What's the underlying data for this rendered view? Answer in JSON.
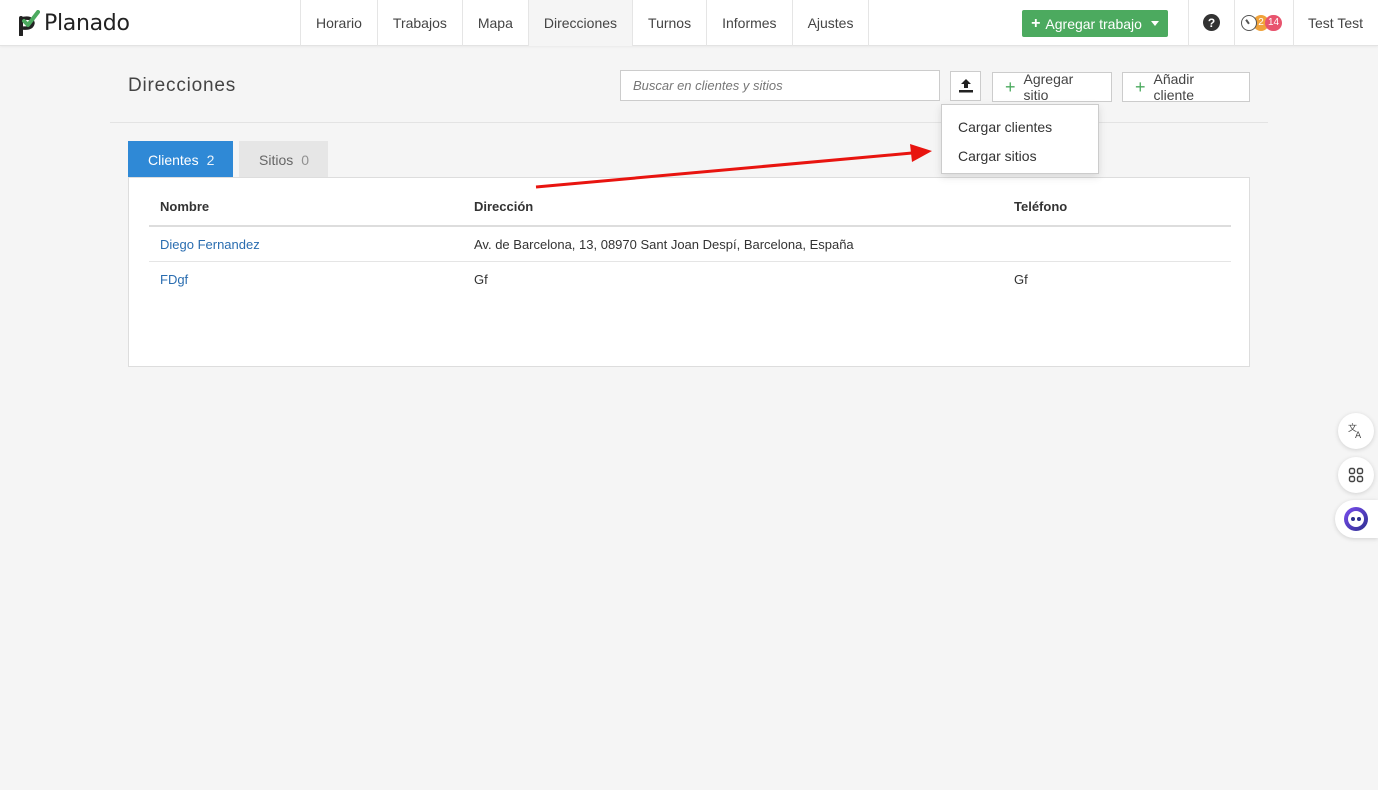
{
  "app": {
    "logo_text": "Planado",
    "brand_color": "#4caa5f"
  },
  "nav": {
    "items": [
      {
        "label": "Horario"
      },
      {
        "label": "Trabajos"
      },
      {
        "label": "Mapa"
      },
      {
        "label": "Direcciones",
        "active": true
      },
      {
        "label": "Turnos"
      },
      {
        "label": "Informes"
      },
      {
        "label": "Ajustes"
      }
    ],
    "add_job_label": "Agregar trabajo",
    "help_icon": "question-circle-icon",
    "notification_badges": [
      "2",
      "14"
    ],
    "user_name": "Test Test"
  },
  "page": {
    "title": "Direcciones",
    "search_placeholder": "Buscar en clientes y sitios",
    "upload_icon": "upload-icon",
    "add_site_label": "Agregar sitio",
    "add_client_label": "Añadir cliente",
    "upload_menu": {
      "items": [
        "Cargar clientes",
        "Cargar sitios"
      ]
    }
  },
  "tabs": [
    {
      "label": "Clientes",
      "count": "2",
      "active": true,
      "color": "#2f89d6"
    },
    {
      "label": "Sitios",
      "count": "0",
      "active": false
    }
  ],
  "table": {
    "headers": [
      "Nombre",
      "Dirección",
      "Teléfono"
    ],
    "rows": [
      {
        "nombre": "Diego Fernandez",
        "direccion": "Av. de Barcelona, 13, 08970 Sant Joan Despí, Barcelona, España",
        "telefono": ""
      },
      {
        "nombre": "FDgf",
        "direccion": "Gf",
        "telefono": "Gf"
      }
    ]
  },
  "annotation": {
    "arrow_color": "#e8140f"
  }
}
